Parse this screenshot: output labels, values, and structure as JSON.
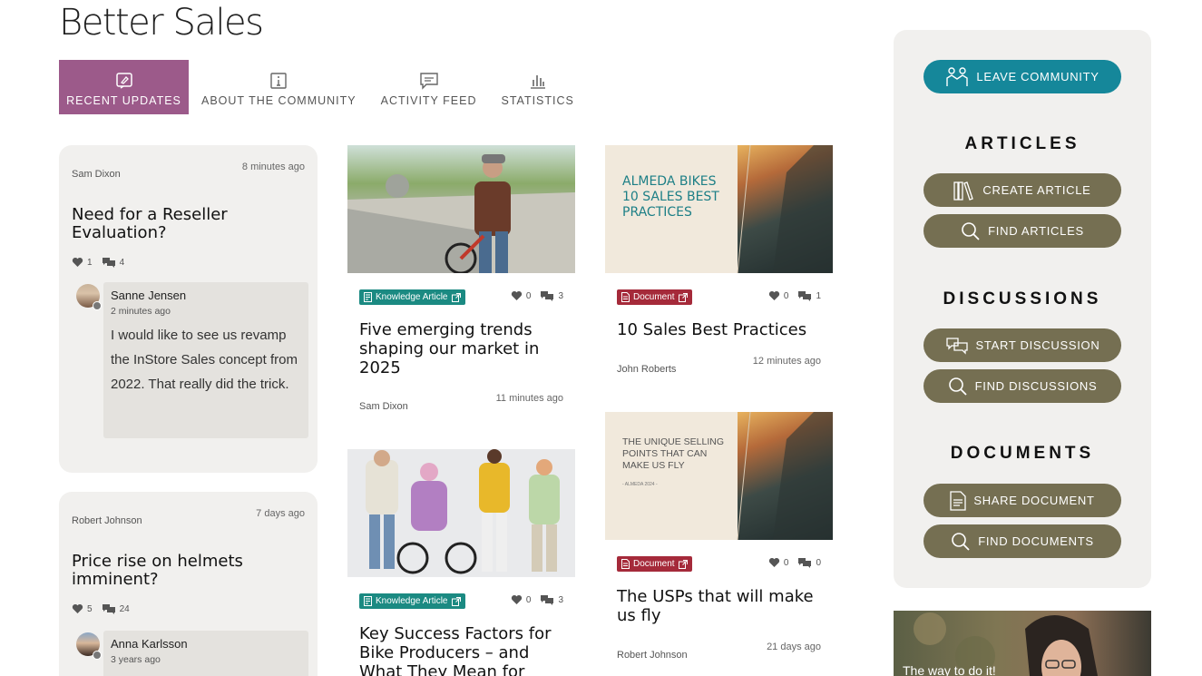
{
  "page": {
    "title": "Better Sales"
  },
  "tabs": [
    {
      "label": "RECENT UPDATES",
      "icon": "edit-note-icon",
      "active": true
    },
    {
      "label": "ABOUT THE COMMUNITY",
      "icon": "info-icon",
      "active": false
    },
    {
      "label": "ACTIVITY FEED",
      "icon": "comment-icon",
      "active": false
    },
    {
      "label": "STATISTICS",
      "icon": "bar-chart-icon",
      "active": false
    }
  ],
  "discussions": [
    {
      "author": "Sam Dixon",
      "time": "8 minutes ago",
      "title": "Need for a Reseller Evaluation?",
      "likes": "1",
      "comments": "4",
      "reply": {
        "author": "Sanne Jensen",
        "time": "2 minutes ago",
        "text": "I would like to see us revamp the InStore Sales concept from 2022. That really did the trick."
      }
    },
    {
      "author": "Robert Johnson",
      "time": "7 days ago",
      "title": "Price rise on helmets imminent?",
      "likes": "5",
      "comments": "24",
      "reply": {
        "author": "Anna Karlsson",
        "time": "3 years ago"
      }
    }
  ],
  "tiles": [
    {
      "tag": "Knowledge Article",
      "likes": "0",
      "comments": "3",
      "title": "Five emerging trends shaping our market in 2025",
      "author": "Sam Dixon",
      "time": "11 minutes ago"
    },
    {
      "tag": "Document",
      "likes": "0",
      "comments": "1",
      "title": "10 Sales Best Practices",
      "author": "John Roberts",
      "time": "12 minutes ago",
      "image_text": "ALMEDA BIKES\n10 SALES BEST\nPRACTICES"
    },
    {
      "tag": "Knowledge Article",
      "likes": "0",
      "comments": "3",
      "title": "Key Success Factors for Bike Producers – and What They Mean for"
    },
    {
      "tag": "Document",
      "likes": "0",
      "comments": "0",
      "title": "The USPs that will make us fly",
      "author": "Robert Johnson",
      "time": "21 days ago",
      "image_text": "THE UNIQUE SELLING\nPOINTS THAT CAN\nMAKE US FLY",
      "image_sub": "- ALMEDA 2024 -"
    }
  ],
  "sidebar": {
    "leave": "LEAVE COMMUNITY",
    "articles": {
      "heading": "ARTICLES",
      "create": "CREATE ARTICLE",
      "find": "FIND ARTICLES"
    },
    "discussions": {
      "heading": "DISCUSSIONS",
      "start": "START DISCUSSION",
      "find": "FIND DISCUSSIONS"
    },
    "documents": {
      "heading": "DOCUMENTS",
      "share": "SHARE DOCUMENT",
      "find": "FIND DOCUMENTS"
    }
  },
  "promo": {
    "text": "The way to do it!"
  },
  "colors": {
    "accent_tab": "#9c5a8a",
    "teal": "#15879a",
    "olive": "#756f52",
    "ka_tag": "#1b8a82",
    "doc_tag": "#a52a3a"
  }
}
